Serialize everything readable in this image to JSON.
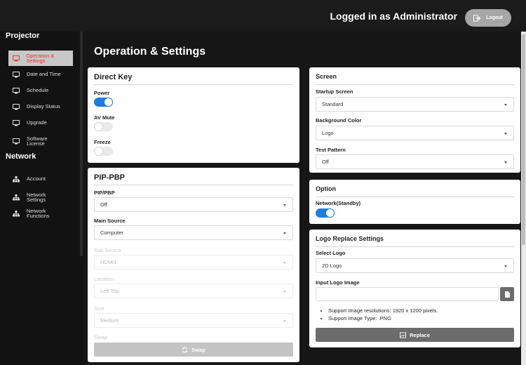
{
  "header": {
    "login_text": "Logged in as Administrator",
    "logout_label": "Logout"
  },
  "sidebar": {
    "groups": [
      {
        "title": "Projector",
        "items": [
          {
            "label": "Operation & Settings",
            "icon": "monitor-icon",
            "active": true
          },
          {
            "label": "Date and Time",
            "icon": "monitor-icon"
          },
          {
            "label": "Schedule",
            "icon": "monitor-icon"
          },
          {
            "label": "Display Status",
            "icon": "monitor-icon"
          },
          {
            "label": "Upgrade",
            "icon": "monitor-icon"
          },
          {
            "label": "Software License",
            "icon": "monitor-icon"
          }
        ]
      },
      {
        "title": "Network",
        "items": [
          {
            "label": "Account",
            "icon": "network-icon"
          },
          {
            "label": "Network Settings",
            "icon": "network-icon"
          },
          {
            "label": "Network Functions",
            "icon": "network-icon"
          }
        ]
      }
    ]
  },
  "main": {
    "title": "Operation & Settings",
    "direct_key": {
      "title": "Direct Key",
      "power": {
        "label": "Power",
        "on": true
      },
      "av_mute": {
        "label": "AV Mute",
        "on": false
      },
      "freeze": {
        "label": "Freeze",
        "on": false
      }
    },
    "pip_pbp": {
      "title": "PIP-PBP",
      "pip_pbp": {
        "label": "PIP/PBP",
        "value": "Off"
      },
      "main_source": {
        "label": "Main Source",
        "value": "Computer"
      },
      "sub_source": {
        "label": "Sub Source",
        "value": "HDMI1",
        "disabled": true
      },
      "location": {
        "label": "Location",
        "value": "Left Top",
        "disabled": true
      },
      "size": {
        "label": "Size",
        "value": "Medium",
        "disabled": true
      },
      "swap": {
        "label": "Swap",
        "button_label": "Swap",
        "disabled": true
      }
    },
    "screen": {
      "title": "Screen",
      "startup_screen": {
        "label": "Startup Screen",
        "value": "Standard"
      },
      "background_color": {
        "label": "Background Color",
        "value": "Logo"
      },
      "test_pattern": {
        "label": "Test Pattern",
        "value": "Off"
      }
    },
    "option": {
      "title": "Option",
      "network_standby": {
        "label": "Network(Standby)",
        "on": true
      }
    },
    "logo_replace": {
      "title": "Logo Replace Settings",
      "select_logo": {
        "label": "Select Logo",
        "value": "2D Logo"
      },
      "input_logo_image": {
        "label": "Input Logo Image",
        "value": ""
      },
      "notes": [
        "Support Image resolutions: 1920 x 1200 pixels.",
        "Support Image Type: .PNG"
      ],
      "replace_label": "Replace"
    }
  },
  "colors": {
    "accent_blue": "#1f7de0",
    "active_red": "#e8352b",
    "replace_button": "#6c6c6c",
    "swap_disabled": "#c4c4c4"
  }
}
